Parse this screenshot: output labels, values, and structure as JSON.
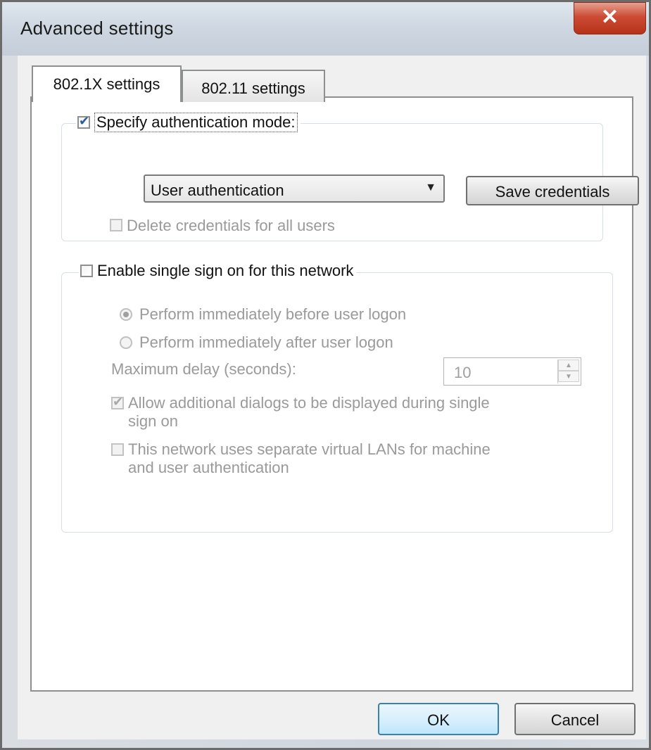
{
  "window": {
    "title": "Advanced settings",
    "close_glyph": "✕"
  },
  "tabs": [
    {
      "label": "802.1X settings",
      "active": true
    },
    {
      "label": "802.11 settings",
      "active": false
    }
  ],
  "auth_group": {
    "specify_mode_label": "Specify authentication mode:",
    "specify_mode_checked": true,
    "mode_value": "User authentication",
    "dropdown_arrow": "▼",
    "save_credentials_label": "Save credentials",
    "delete_credentials_label": "Delete credentials for all users",
    "delete_credentials_checked": false
  },
  "sso_group": {
    "enable_label": "Enable single sign on for this network",
    "enable_checked": false,
    "radio_before_label": "Perform immediately before user logon",
    "radio_after_label": "Perform immediately after user logon",
    "max_delay_label": "Maximum delay (seconds):",
    "max_delay_value": "10",
    "allow_dialogs_label_line1": "Allow additional dialogs to be displayed during single",
    "allow_dialogs_label_line2": "sign on",
    "allow_dialogs_checked": true,
    "vlan_label_line1": "This network uses separate virtual LANs for machine",
    "vlan_label_line2": "and user authentication",
    "vlan_checked": false
  },
  "footer": {
    "ok_label": "OK",
    "cancel_label": "Cancel"
  },
  "annotations": {
    "arrow_color": "#000000"
  }
}
